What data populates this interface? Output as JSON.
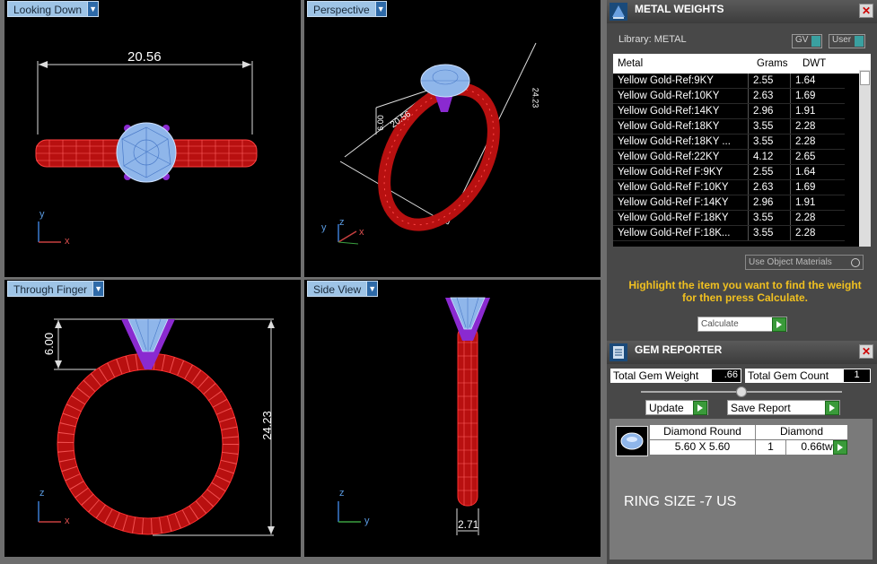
{
  "viewports": {
    "top_left": {
      "label": "Looking Down",
      "dim": "20.56",
      "axis_v": "y",
      "axis_h": "x"
    },
    "top_right": {
      "label": "Perspective",
      "dim_a": "20.56",
      "dim_b": "6.00",
      "dim_c": "24.23",
      "axis_v": "z",
      "axis_h": "x",
      "axis_y": "y"
    },
    "bottom_left": {
      "label": "Through Finger",
      "dim_top": "6.00",
      "dim_side": "24.23",
      "axis_v": "z",
      "axis_h": "x"
    },
    "bottom_right": {
      "label": "Side View",
      "dim": "2.71",
      "axis_v": "z",
      "axis_h": "y"
    }
  },
  "metal": {
    "title": "METAL WEIGHTS",
    "library": "Library: METAL",
    "gv": "GV",
    "user": "User",
    "headers": {
      "metal": "Metal",
      "grams": "Grams",
      "dwt": "DWT"
    },
    "rows": [
      [
        "Yellow Gold-Ref:9KY",
        "2.55",
        "1.64"
      ],
      [
        "Yellow Gold-Ref:10KY",
        "2.63",
        "1.69"
      ],
      [
        "Yellow Gold-Ref:14KY",
        "2.96",
        "1.91"
      ],
      [
        "Yellow Gold-Ref:18KY",
        "3.55",
        "2.28"
      ],
      [
        "Yellow Gold-Ref:18KY ...",
        "3.55",
        "2.28"
      ],
      [
        "Yellow Gold-Ref:22KY",
        "4.12",
        "2.65"
      ],
      [
        "Yellow Gold-Ref F:9KY",
        "2.55",
        "1.64"
      ],
      [
        "Yellow Gold-Ref F:10KY",
        "2.63",
        "1.69"
      ],
      [
        "Yellow Gold-Ref F:14KY",
        "2.96",
        "1.91"
      ],
      [
        "Yellow Gold-Ref F:18KY",
        "3.55",
        "2.28"
      ],
      [
        "Yellow Gold-Ref F:18K...",
        "3.55",
        "2.28"
      ]
    ],
    "use_object": "Use Object Materials",
    "hint": "Highlight the item you want to find the weight for then press Calculate.",
    "calculate": "Calculate"
  },
  "gem": {
    "title": "GEM REPORTER",
    "total_weight_label": "Total Gem Weight",
    "total_weight_value": ".66",
    "total_count_label": "Total Gem Count",
    "total_count_value": "1",
    "update": "Update",
    "save_report": "Save Report",
    "shape": "Diamond Round",
    "size": "5.60 X 5.60",
    "material": "Diamond",
    "qty": "1",
    "tw": "0.66tw",
    "note": "RING SIZE -7 US"
  },
  "colors": {
    "ring": "#d01818",
    "gem": "#9cc4f0",
    "prong": "#8a2ad0",
    "hint": "#f0c020"
  }
}
